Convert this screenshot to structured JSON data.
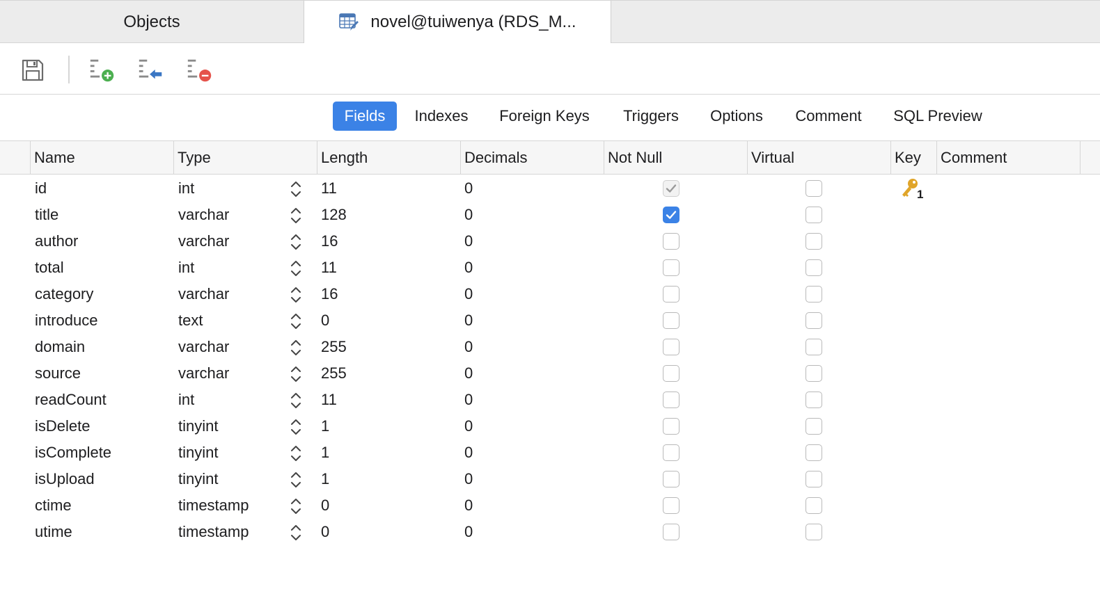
{
  "tabs": {
    "objects_label": "Objects",
    "active_label": "novel@tuiwenya (RDS_M..."
  },
  "toolbar": {
    "save": "save-icon",
    "add_field": "add-field-icon",
    "insert_field": "insert-field-icon",
    "delete_field": "delete-field-icon"
  },
  "subtabs": [
    "Fields",
    "Indexes",
    "Foreign Keys",
    "Triggers",
    "Options",
    "Comment",
    "SQL Preview"
  ],
  "columns": [
    "Name",
    "Type",
    "Length",
    "Decimals",
    "Not Null",
    "Virtual",
    "Key",
    "Comment"
  ],
  "rows": [
    {
      "name": "id",
      "type": "int",
      "length": "11",
      "decimals": "0",
      "not_null": true,
      "not_null_disabled": true,
      "virtual": false,
      "key": "1"
    },
    {
      "name": "title",
      "type": "varchar",
      "length": "128",
      "decimals": "0",
      "not_null": true,
      "virtual": false,
      "key": ""
    },
    {
      "name": "author",
      "type": "varchar",
      "length": "16",
      "decimals": "0",
      "not_null": false,
      "virtual": false,
      "key": ""
    },
    {
      "name": "total",
      "type": "int",
      "length": "11",
      "decimals": "0",
      "not_null": false,
      "virtual": false,
      "key": ""
    },
    {
      "name": "category",
      "type": "varchar",
      "length": "16",
      "decimals": "0",
      "not_null": false,
      "virtual": false,
      "key": ""
    },
    {
      "name": "introduce",
      "type": "text",
      "length": "0",
      "decimals": "0",
      "not_null": false,
      "virtual": false,
      "key": ""
    },
    {
      "name": "domain",
      "type": "varchar",
      "length": "255",
      "decimals": "0",
      "not_null": false,
      "virtual": false,
      "key": ""
    },
    {
      "name": "source",
      "type": "varchar",
      "length": "255",
      "decimals": "0",
      "not_null": false,
      "virtual": false,
      "key": ""
    },
    {
      "name": "readCount",
      "type": "int",
      "length": "11",
      "decimals": "0",
      "not_null": false,
      "virtual": false,
      "key": ""
    },
    {
      "name": "isDelete",
      "type": "tinyint",
      "length": "1",
      "decimals": "0",
      "not_null": false,
      "virtual": false,
      "key": ""
    },
    {
      "name": "isComplete",
      "type": "tinyint",
      "length": "1",
      "decimals": "0",
      "not_null": false,
      "virtual": false,
      "key": ""
    },
    {
      "name": "isUpload",
      "type": "tinyint",
      "length": "1",
      "decimals": "0",
      "not_null": false,
      "virtual": false,
      "key": ""
    },
    {
      "name": "ctime",
      "type": "timestamp",
      "length": "0",
      "decimals": "0",
      "not_null": false,
      "virtual": false,
      "key": ""
    },
    {
      "name": "utime",
      "type": "timestamp",
      "length": "0",
      "decimals": "0",
      "not_null": false,
      "virtual": false,
      "key": ""
    }
  ],
  "colors": {
    "accent": "#3b82e6",
    "key_icon": "#e0a52a",
    "add_green": "#4caf50",
    "delete_red": "#e5534b",
    "insert_blue": "#3a76c4"
  }
}
